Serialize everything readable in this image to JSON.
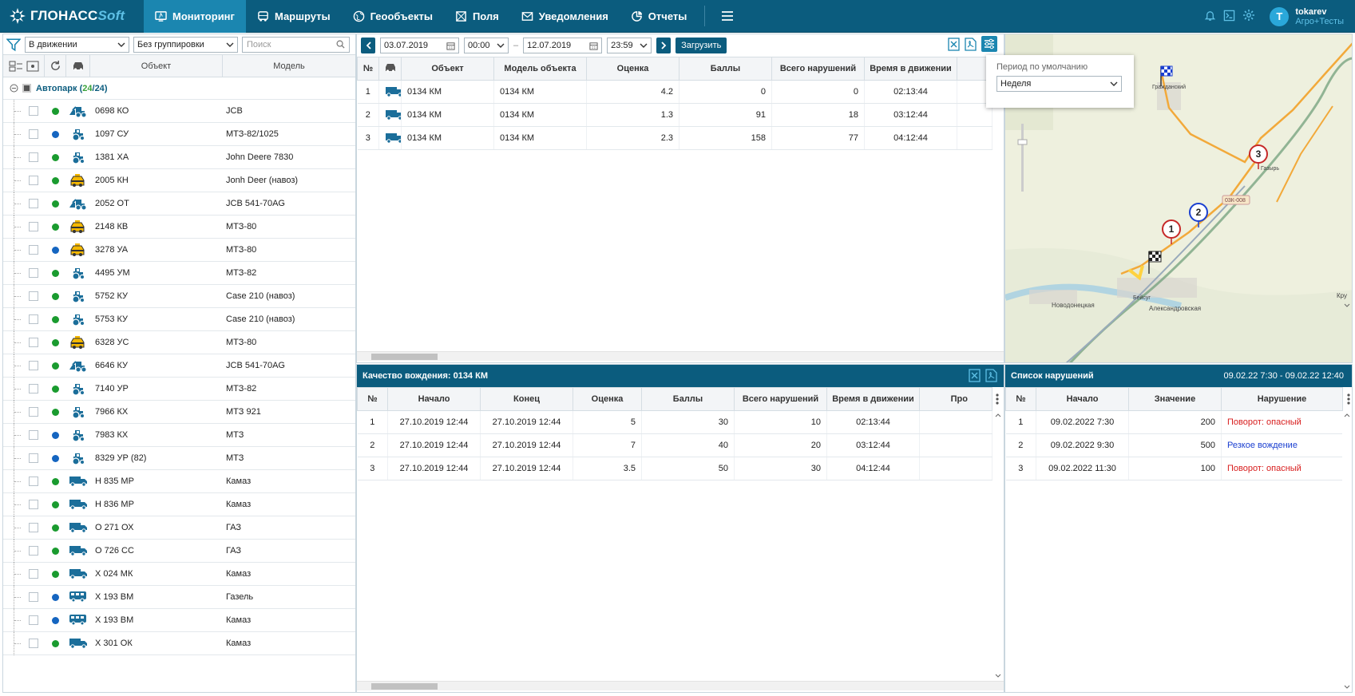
{
  "header": {
    "logo_main": "ГЛОНАСС",
    "logo_soft": "Soft",
    "nav": [
      {
        "label": "Мониторинг",
        "icon": "monitor-icon",
        "active": true
      },
      {
        "label": "Маршруты",
        "icon": "bus-icon",
        "active": false
      },
      {
        "label": "Геообъекты",
        "icon": "globe-icon",
        "active": false
      },
      {
        "label": "Поля",
        "icon": "field-icon",
        "active": false
      },
      {
        "label": "Уведомления",
        "icon": "envelope-icon",
        "active": false
      },
      {
        "label": "Отчеты",
        "icon": "report-icon",
        "active": false
      }
    ],
    "user_initial": "T",
    "user_name": "tokarev",
    "user_org": "Агро+Тесты"
  },
  "left_panel": {
    "filter_value": "В движении",
    "group_value": "Без группировки",
    "search_placeholder": "Поиск",
    "col_object": "Объект",
    "col_model": "Модель",
    "group_name": "Автопарк",
    "group_count": "24",
    "group_total": "24",
    "vehicles": [
      {
        "name": "0698 КО",
        "model": "JCB",
        "status": "green",
        "icon": "loader"
      },
      {
        "name": "1097 СУ",
        "model": "МТЗ-82/1025",
        "status": "blue",
        "icon": "tractor"
      },
      {
        "name": "1381 ХА",
        "model": "John Deere 7830",
        "status": "green",
        "icon": "tractor"
      },
      {
        "name": "2005 КН",
        "model": "Jonh Deer (навоз)",
        "status": "green",
        "icon": "taxi"
      },
      {
        "name": "2052 ОТ",
        "model": "JCB 541-70AG",
        "status": "green",
        "icon": "loader"
      },
      {
        "name": "2148 КВ",
        "model": "МТЗ-80",
        "status": "green",
        "icon": "taxi"
      },
      {
        "name": "3278 УА",
        "model": "МТЗ-80",
        "status": "blue",
        "icon": "taxi"
      },
      {
        "name": "4495 УМ",
        "model": "МТЗ-82",
        "status": "green",
        "icon": "tractor"
      },
      {
        "name": "5752 КУ",
        "model": "Case 210 (навоз)",
        "status": "green",
        "icon": "tractor"
      },
      {
        "name": "5753 КУ",
        "model": "Case 210 (навоз)",
        "status": "green",
        "icon": "tractor"
      },
      {
        "name": "6328 УС",
        "model": "МТЗ-80",
        "status": "green",
        "icon": "taxi"
      },
      {
        "name": "6646 КУ",
        "model": "JCB 541-70AG",
        "status": "green",
        "icon": "loader"
      },
      {
        "name": "7140 УР",
        "model": "МТЗ-82",
        "status": "green",
        "icon": "tractor"
      },
      {
        "name": "7966 КХ",
        "model": "МТЗ 921",
        "status": "green",
        "icon": "tractor"
      },
      {
        "name": "7983 КХ",
        "model": "МТЗ",
        "status": "blue",
        "icon": "tractor"
      },
      {
        "name": "8329 УР (82)",
        "model": "МТЗ",
        "status": "blue",
        "icon": "tractor"
      },
      {
        "name": "Н 835 МР",
        "model": "Камаз",
        "status": "green",
        "icon": "truck"
      },
      {
        "name": "Н 836 МР",
        "model": "Камаз",
        "status": "green",
        "icon": "truck"
      },
      {
        "name": "О 271 ОХ",
        "model": "ГАЗ",
        "status": "green",
        "icon": "truck"
      },
      {
        "name": "О 726 СС",
        "model": "ГАЗ",
        "status": "green",
        "icon": "truck"
      },
      {
        "name": "Х 024 МК",
        "model": "Камаз",
        "status": "green",
        "icon": "truck"
      },
      {
        "name": "Х 193 ВМ",
        "model": "Газель",
        "status": "blue",
        "icon": "bus"
      },
      {
        "name": "Х 193 ВМ",
        "model": "Камаз",
        "status": "blue",
        "icon": "bus"
      },
      {
        "name": "Х 301 ОК",
        "model": "Камаз",
        "status": "green",
        "icon": "truck"
      }
    ]
  },
  "toolbar": {
    "date_from": "03.07.2019",
    "time_from": "00:00",
    "dash": "–",
    "date_to": "12.07.2019",
    "time_to": "23:59",
    "load_label": "Загрузить"
  },
  "summary_table": {
    "headers": [
      "№",
      "",
      "Объект",
      "Модель объекта",
      "Оценка",
      "Баллы",
      "Всего нарушений",
      "Время в движении"
    ],
    "rows": [
      {
        "n": "1",
        "object": "0134 КМ",
        "model": "0134 КМ",
        "score": "4.2",
        "points": "0",
        "violations": "0",
        "time": "02:13:44"
      },
      {
        "n": "2",
        "object": "0134 КМ",
        "model": "0134 КМ",
        "score": "1.3",
        "points": "91",
        "violations": "18",
        "time": "03:12:44"
      },
      {
        "n": "3",
        "object": "0134 КМ",
        "model": "0134 КМ",
        "score": "2.3",
        "points": "158",
        "violations": "77",
        "time": "04:12:44"
      }
    ]
  },
  "popup": {
    "label": "Период по умолчанию",
    "value": "Неделя"
  },
  "map": {
    "labels": [
      "Гражданский",
      "Газырь",
      "03К-008",
      "Новодонецкая",
      "Александровская",
      "Бейсуг",
      "Кру"
    ],
    "markers": [
      "1",
      "2",
      "3"
    ]
  },
  "quality_panel": {
    "title": "Качество вождения: 0134 КМ",
    "headers": [
      "№",
      "Начало",
      "Конец",
      "Оценка",
      "Баллы",
      "Всего нарушений",
      "Время в движении",
      "Про"
    ],
    "rows": [
      {
        "n": "1",
        "start": "27.10.2019 12:44",
        "end": "27.10.2019 12:44",
        "score": "5",
        "points": "30",
        "violations": "10",
        "time": "02:13:44"
      },
      {
        "n": "2",
        "start": "27.10.2019 12:44",
        "end": "27.10.2019 12:44",
        "score": "7",
        "points": "40",
        "violations": "20",
        "time": "03:12:44"
      },
      {
        "n": "3",
        "start": "27.10.2019 12:44",
        "end": "27.10.2019 12:44",
        "score": "3.5",
        "points": "50",
        "violations": "30",
        "time": "04:12:44"
      }
    ]
  },
  "violations_panel": {
    "title": "Список нарушений",
    "period": "09.02.22 7:30 - 09.02.22 12:40",
    "headers": [
      "№",
      "Начало",
      "Значение",
      "Нарушение"
    ],
    "rows": [
      {
        "n": "1",
        "start": "09.02.2022 7:30",
        "value": "200",
        "type": "Поворот: опасный",
        "color": "#d81e1e"
      },
      {
        "n": "2",
        "start": "09.02.2022 9:30",
        "value": "500",
        "type": "Резкое вождение",
        "color": "#1a3fd0"
      },
      {
        "n": "3",
        "start": "09.02.2022 11:30",
        "value": "100",
        "type": "Поворот: опасный",
        "color": "#d81e1e"
      }
    ]
  },
  "colors": {
    "brand": "#0b5c7e",
    "accent": "#1b86b0",
    "status_green": "#1a9b2f",
    "status_blue": "#1565c0"
  }
}
